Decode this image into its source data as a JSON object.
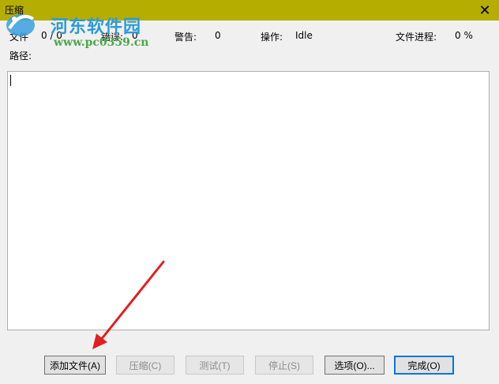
{
  "window": {
    "title": "压缩",
    "close_glyph": "✕",
    "frame_color": "#b5ad00"
  },
  "stats": {
    "files_label": "文件",
    "files_value": "0 / 0",
    "errors_label": "错误:",
    "errors_value": "0",
    "warnings_label": "警告:",
    "warnings_value": "0",
    "operation_label": "操作:",
    "operation_value": "Idle",
    "progress_label": "文件进程:",
    "progress_value": "0 %",
    "path_label": "路径:"
  },
  "buttons": [
    {
      "id": "add-files",
      "label": "添加文件(A)",
      "enabled": true
    },
    {
      "id": "compress",
      "label": "压缩(C)",
      "enabled": false
    },
    {
      "id": "test",
      "label": "测试(T)",
      "enabled": false
    },
    {
      "id": "stop",
      "label": "停止(S)",
      "enabled": false
    },
    {
      "id": "options",
      "label": "选项(O)...",
      "enabled": true
    },
    {
      "id": "done",
      "label": "完成(O)",
      "enabled": true,
      "default": true
    }
  ],
  "watermark": {
    "title": "河东软件园",
    "url": "www.pc0359.cn"
  },
  "annotation": {
    "arrow_color": "#e02020"
  }
}
